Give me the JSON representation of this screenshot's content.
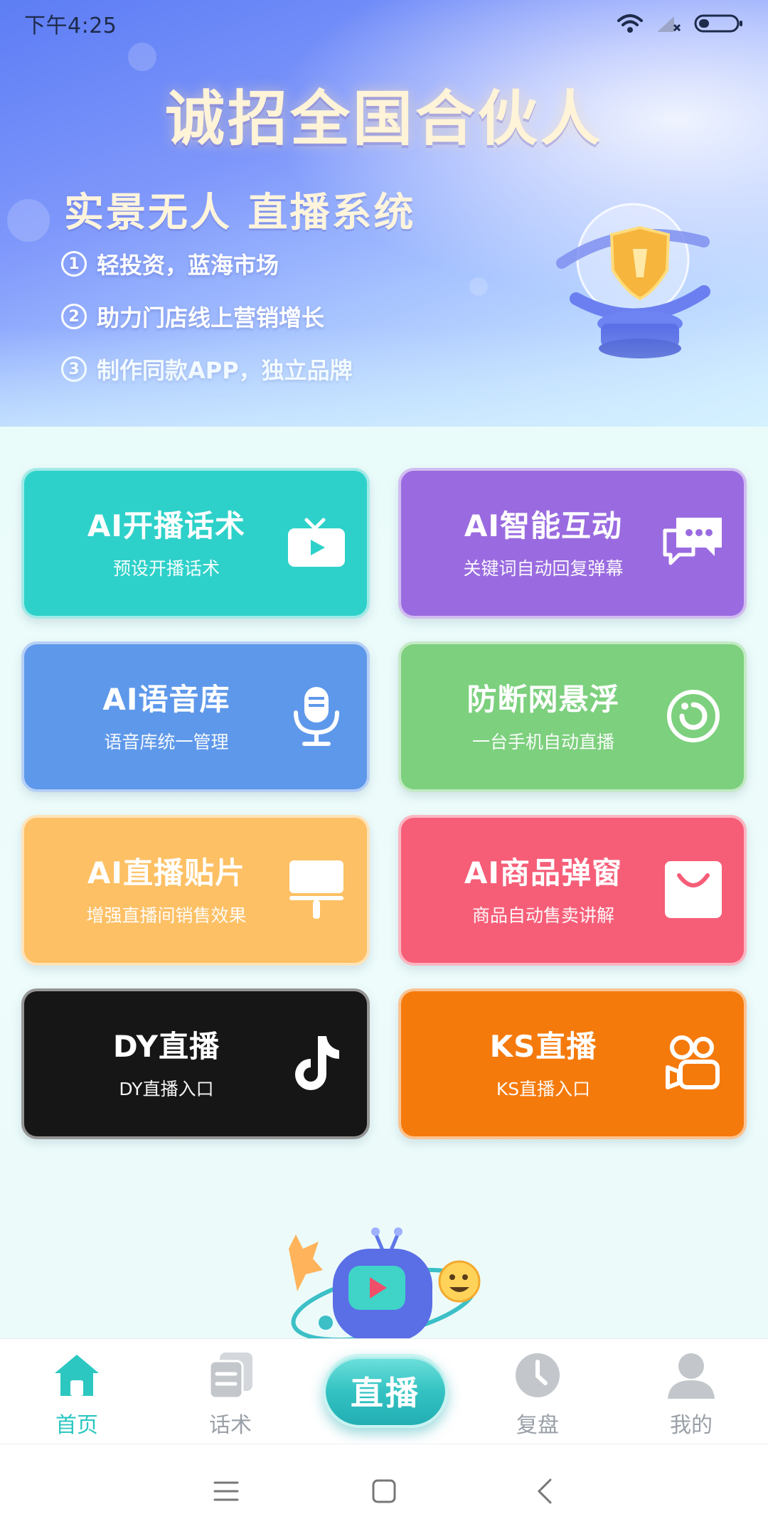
{
  "status_bar": {
    "time": "下午4:25"
  },
  "banner": {
    "title": "诚招全国合伙人",
    "subtitle": "实景无人 直播系统",
    "points": [
      {
        "num": "1",
        "text": "轻投资，蓝海市场"
      },
      {
        "num": "2",
        "text": "助力门店线上营销增长"
      },
      {
        "num": "3",
        "text": "制作同款APP，独立品牌"
      }
    ]
  },
  "cards": [
    {
      "title": "AI开播话术",
      "subtitle": "预设开播话术",
      "icon": "tv-play-icon",
      "color": "#2ed1c9"
    },
    {
      "title": "AI智能互动",
      "subtitle": "关键词自动回复弹幕",
      "icon": "chat-bubbles-icon",
      "color": "#9a6be0"
    },
    {
      "title": "AI语音库",
      "subtitle": "语音库统一管理",
      "icon": "microphone-icon",
      "color": "#5e98ea"
    },
    {
      "title": "防断网悬浮",
      "subtitle": "一台手机自动直播",
      "icon": "refresh-ring-icon",
      "color": "#7dd07e"
    },
    {
      "title": "AI直播贴片",
      "subtitle": "增强直播间销售效果",
      "icon": "paint-roller-icon",
      "color": "#fdc064"
    },
    {
      "title": "AI商品弹窗",
      "subtitle": "商品自动售卖讲解",
      "icon": "shopping-bag-icon",
      "color": "#f65e78"
    },
    {
      "title": "DY直播",
      "subtitle": "DY直播入口",
      "icon": "tiktok-icon",
      "color": "#161616"
    },
    {
      "title": "KS直播",
      "subtitle": "KS直播入口",
      "icon": "kuaishou-camera-icon",
      "color": "#f57a0c"
    }
  ],
  "nav": {
    "items": [
      {
        "label": "首页",
        "icon": "home-icon",
        "active": true
      },
      {
        "label": "话术",
        "icon": "script-icon",
        "active": false
      },
      {
        "label": "复盘",
        "icon": "clock-icon",
        "active": false
      },
      {
        "label": "我的",
        "icon": "user-icon",
        "active": false
      }
    ],
    "live_label": "直播"
  },
  "colors": {
    "accent": "#2dc7c1",
    "inactive": "#c3c7cc"
  }
}
